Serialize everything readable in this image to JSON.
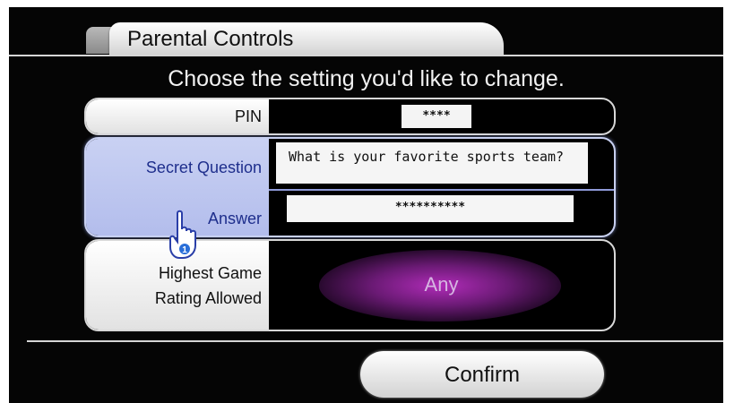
{
  "header": {
    "title": "Parental Controls"
  },
  "subtitle": "Choose the setting you'd like to change.",
  "pin": {
    "label": "PIN",
    "value": "****"
  },
  "secret": {
    "question_label": "Secret Question",
    "question_value": "What is your favorite sports team?",
    "answer_label": "Answer",
    "answer_value": "**********"
  },
  "rating": {
    "label_line1": "Highest Game",
    "label_line2": "Rating Allowed",
    "value": "Any"
  },
  "confirm": {
    "label": "Confirm"
  },
  "pointer": {
    "player_number": "1",
    "icon": "hand-pointer-icon"
  },
  "colors": {
    "highlight": "#c3cbf0",
    "accent_text": "#1e2e8c",
    "rating_glow": "#b02cb8"
  }
}
